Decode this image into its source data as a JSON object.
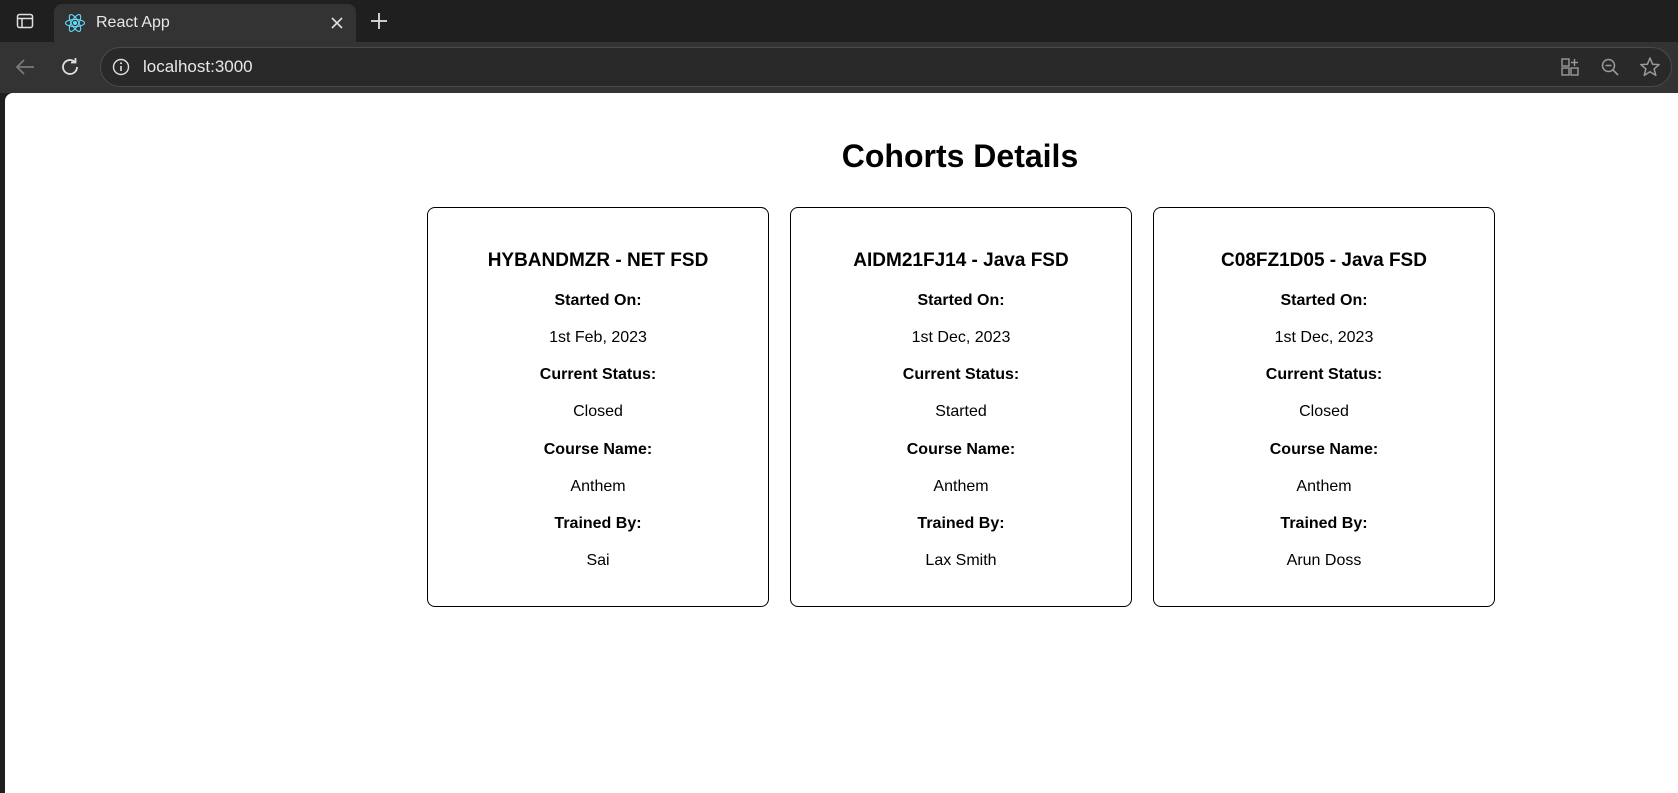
{
  "browser": {
    "tab": {
      "title": "React App"
    },
    "address_bar": {
      "url": "localhost:3000"
    }
  },
  "page": {
    "title": "Cohorts Details",
    "labels": {
      "started_on": "Started On:",
      "current_status": "Current Status:",
      "course_name": "Course Name:",
      "trained_by": "Trained By:"
    },
    "cohorts": [
      {
        "title": "HYBANDMZR - NET FSD",
        "started_on": "1st Feb, 2023",
        "current_status": "Closed",
        "course_name": "Anthem",
        "trained_by": "Sai"
      },
      {
        "title": "AIDM21FJ14 - Java FSD",
        "started_on": "1st Dec, 2023",
        "current_status": "Started",
        "course_name": "Anthem",
        "trained_by": "Lax Smith"
      },
      {
        "title": "C08FZ1D05 - Java FSD",
        "started_on": "1st Dec, 2023",
        "current_status": "Closed",
        "course_name": "Anthem",
        "trained_by": "Arun Doss"
      }
    ]
  },
  "icons": {
    "tab_actions": "tab-actions-icon",
    "favicon": "react-logo-icon",
    "tab_close": "close-icon",
    "new_tab": "plus-icon",
    "back": "back-arrow-icon",
    "reload": "reload-icon",
    "site_info": "info-icon",
    "apps": "apps-icon",
    "zoom": "zoom-out-icon",
    "favorite": "star-icon"
  },
  "colors": {
    "chrome_bg": "#1f1f1f",
    "toolbar_bg": "#333333",
    "page_bg": "#ffffff",
    "react_blue": "#61dafb"
  }
}
